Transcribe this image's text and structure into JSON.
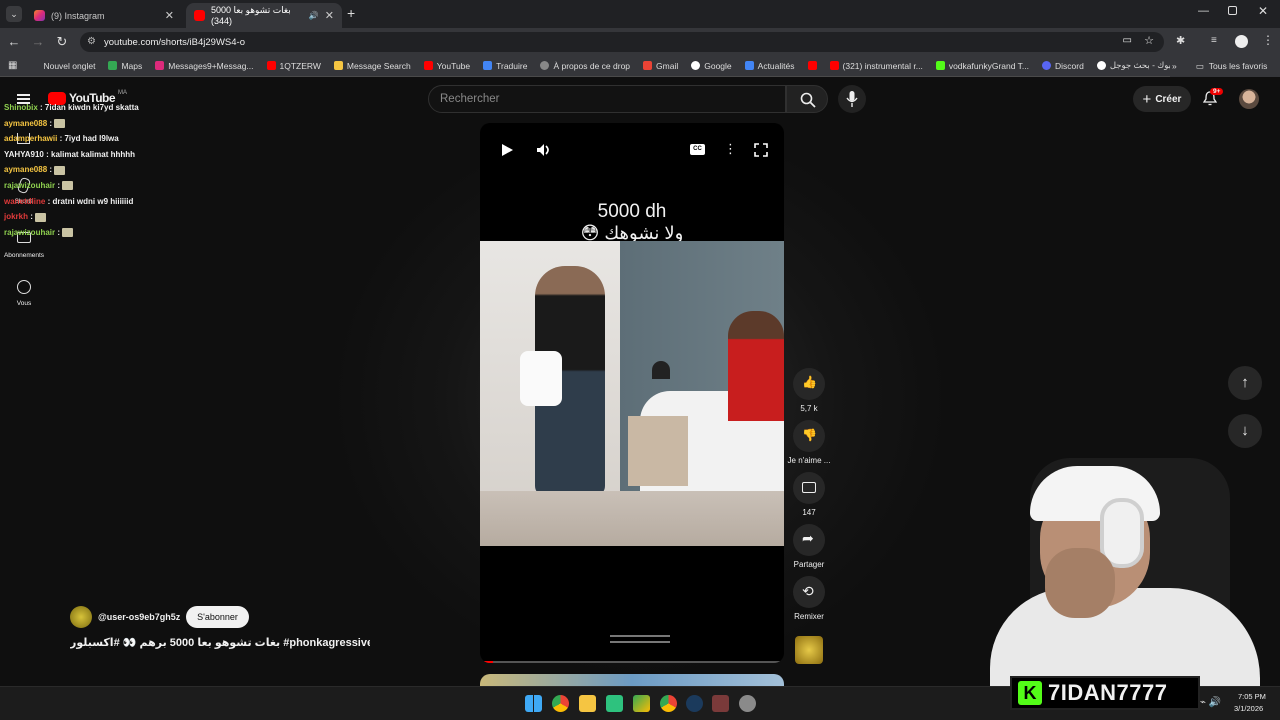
{
  "tabs": [
    {
      "title": "(9) Instagram"
    },
    {
      "title": "5000 بغات تشوهو بعا (344)"
    }
  ],
  "url": "youtube.com/shorts/iB4j29WS4-o",
  "bookmarks": [
    "Nouvel onglet",
    "Maps",
    "Messages9+Messag...",
    "1QTZERW",
    "Message Search",
    "YouTube",
    "Traduire",
    "À propos de ce drop",
    "Gmail",
    "Google",
    "Actualités",
    "",
    "(321) instrumental r...",
    "vodkafunkyGrand T...",
    "Discord",
    "الفيسبوك - بحث جوجل"
  ],
  "all_bookmarks": "Tous les favoris",
  "yt": {
    "brand": "YouTube",
    "region": "MA",
    "search_placeholder": "Rechercher",
    "create": "Créer",
    "notif": "9+"
  },
  "sidebar": [
    "Shorts",
    "Abonnements",
    "Vous"
  ],
  "chat": [
    {
      "user": "Shinobix",
      "msg": "7idan kiwdn ki7yd skatta",
      "color": "#8fd14f"
    },
    {
      "user": "aymane088",
      "msg": "",
      "color": "#f5c542"
    },
    {
      "user": "adamperhawii",
      "msg": "7iyd had l9lwa",
      "color": "#f5c542"
    },
    {
      "user": "YAHYA910",
      "msg": "kalimat kalimat hhhhh",
      "color": "#f0f0f0"
    },
    {
      "user": "aymane088",
      "msg": "",
      "color": "#f5c542"
    },
    {
      "user": "rajawizouhair",
      "msg": "",
      "color": "#8fd14f"
    },
    {
      "user": "wanetdline",
      "msg": "dratni wdni w9 hiiiiiid",
      "color": "#e03a3a"
    },
    {
      "user": "jokrkh",
      "msg": "",
      "color": "#e03a3a"
    },
    {
      "user": "rajawizouhair",
      "msg": "",
      "color": "#8fd14f"
    }
  ],
  "video": {
    "title_line1": "5000 dh",
    "title_line2": "ولا نشوهك 😳",
    "caption": "بغات تشوهو بعا 5000 برهم 👀 #اكسبلور #phonkagressive..."
  },
  "channel": {
    "handle": "@user-os9eb7gh5z",
    "subscribe": "S'abonner"
  },
  "actions": {
    "likes": "5,7 k",
    "dislike": "Je n'aime ...",
    "comments": "147",
    "share": "Partager",
    "remix": "Remixer"
  },
  "streamer": "7IDAN7777",
  "clock": {
    "time": "7:05 PM",
    "date": "3/1/2026"
  }
}
